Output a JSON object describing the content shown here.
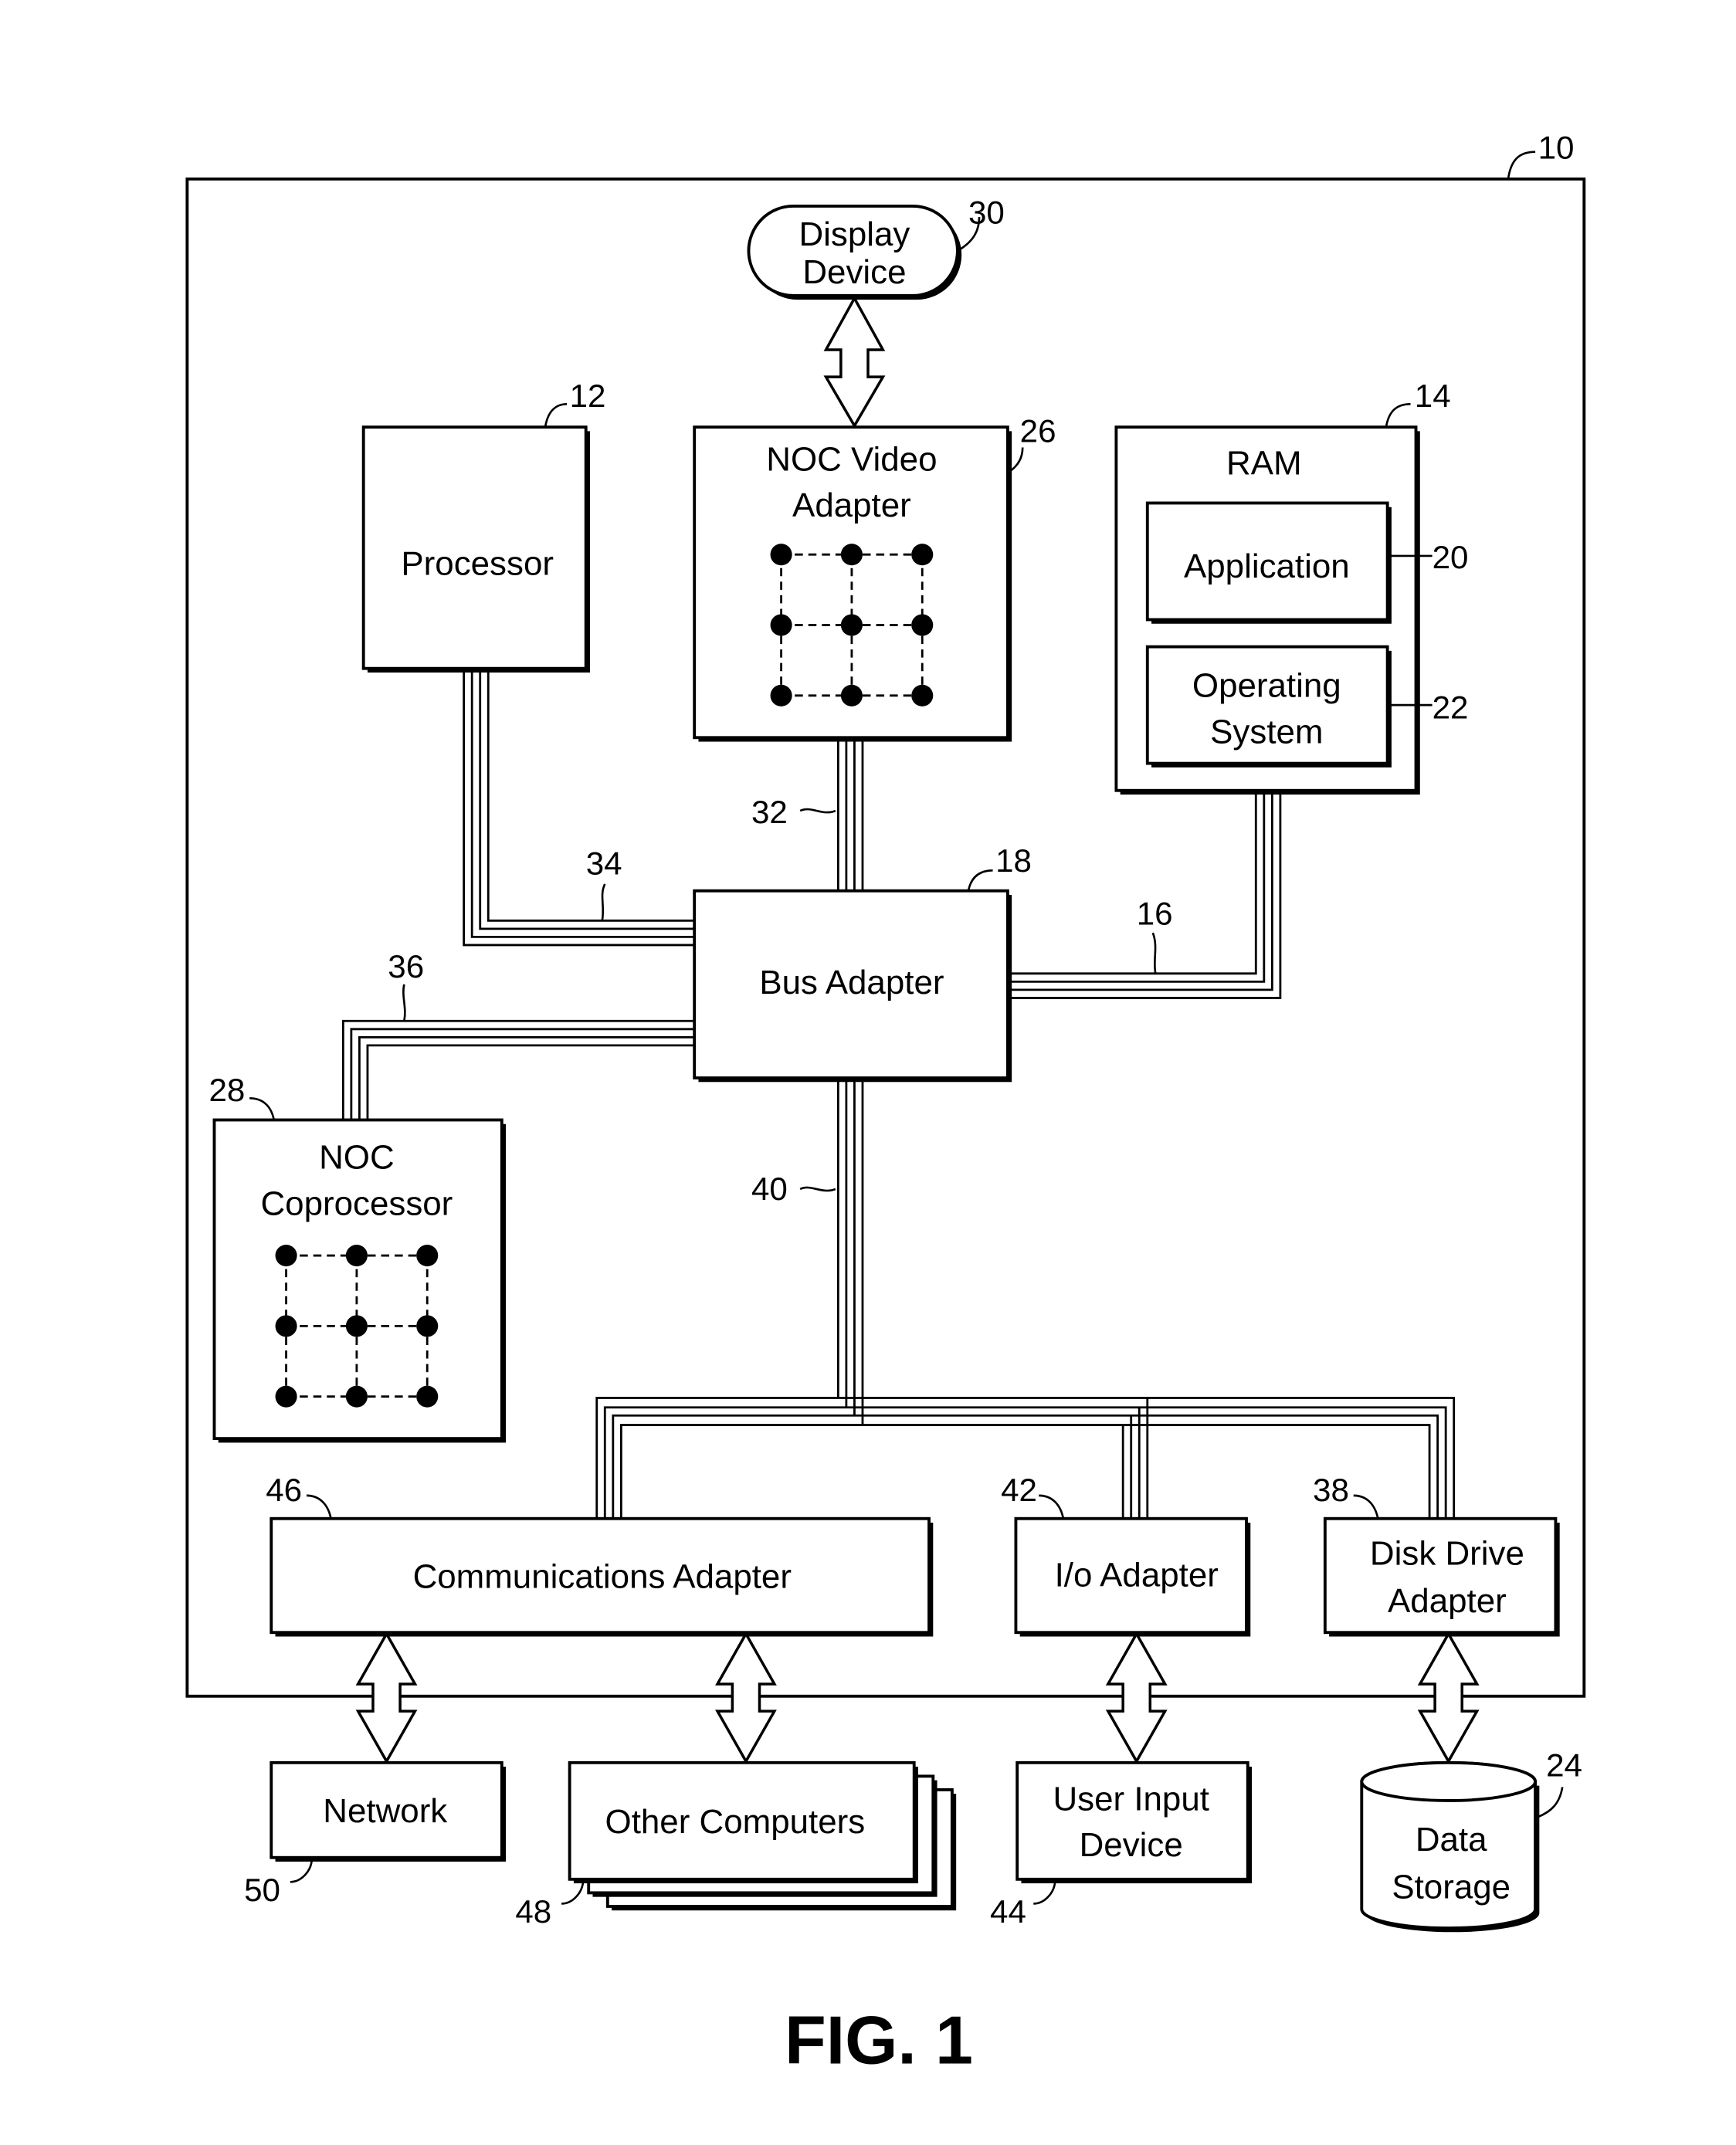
{
  "figure": {
    "caption": "FIG. 1",
    "system_ref": "10"
  },
  "components": {
    "display_device": {
      "lines": [
        "Display",
        "Device"
      ],
      "ref": "30"
    },
    "processor": {
      "label": "Processor",
      "ref": "12"
    },
    "noc_video_adapter": {
      "lines": [
        "NOC Video",
        "Adapter"
      ],
      "ref": "26"
    },
    "ram": {
      "label": "RAM",
      "ref": "14"
    },
    "application": {
      "label": "Application",
      "ref": "20"
    },
    "operating_system": {
      "lines": [
        "Operating",
        "System"
      ],
      "ref": "22"
    },
    "bus_adapter": {
      "label": "Bus Adapter",
      "ref": "18"
    },
    "noc_coprocessor": {
      "lines": [
        "NOC",
        "Coprocessor"
      ],
      "ref": "28"
    },
    "communications_adapter": {
      "label": "Communications Adapter",
      "ref": "46"
    },
    "io_adapter": {
      "label": "I/o Adapter",
      "ref": "42"
    },
    "disk_drive_adapter": {
      "lines": [
        "Disk Drive",
        "Adapter"
      ],
      "ref": "38"
    },
    "network": {
      "label": "Network",
      "ref": "50"
    },
    "other_computers": {
      "label": "Other Computers",
      "ref": "48"
    },
    "user_input_device": {
      "lines": [
        "User Input",
        "Device"
      ],
      "ref": "44"
    },
    "data_storage": {
      "lines": [
        "Data",
        "Storage"
      ],
      "ref": "24"
    }
  },
  "buses": {
    "video_bus": {
      "ref": "32"
    },
    "front_side_bus": {
      "ref": "34"
    },
    "memory_bus": {
      "ref": "16"
    },
    "coprocessor_bus": {
      "ref": "36"
    },
    "expansion_bus": {
      "ref": "40"
    }
  }
}
